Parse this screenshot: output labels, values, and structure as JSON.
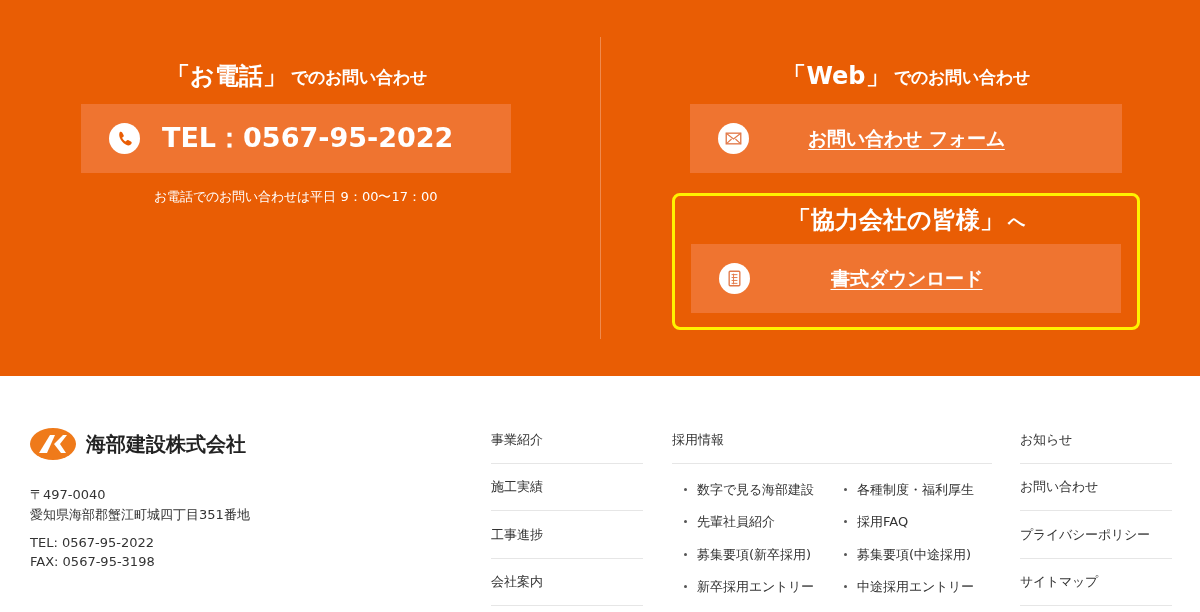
{
  "contact": {
    "phone": {
      "heading_main": "「お電話」",
      "heading_sub": "でのお問い合わせ",
      "button": "TEL：0567-95-2022",
      "note": "お電話でのお問い合わせは平日 9：00〜17：00"
    },
    "web": {
      "heading_main": "「Web」",
      "heading_sub": "でのお問い合わせ",
      "button": "お問い合わせ フォーム"
    },
    "partners": {
      "highlighted": true,
      "heading_main": "「協力会社の皆様」",
      "heading_sub": "へ",
      "button": "書式ダウンロード"
    }
  },
  "footer": {
    "company": "海部建設株式会社",
    "postal": "〒497-0040",
    "address": "愛知県海部郡蟹江町城四丁目351番地",
    "tel": "TEL: 0567-95-2022",
    "fax": "FAX: 0567-95-3198",
    "nav_left": [
      "事業紹介",
      "施工実績",
      "工事進捗",
      "会社案内"
    ],
    "recruit": {
      "title": "採用情報",
      "items": [
        "数字で見る海部建設",
        "各種制度・福利厚生",
        "先輩社員紹介",
        "採用FAQ",
        "募集要項(新卒採用)",
        "募集要項(中途採用)",
        "新卒採用エントリー",
        "中途採用エントリー"
      ]
    },
    "nav_right": [
      "お知らせ",
      "お問い合わせ",
      "プライバシーポリシー",
      "サイトマップ"
    ]
  }
}
